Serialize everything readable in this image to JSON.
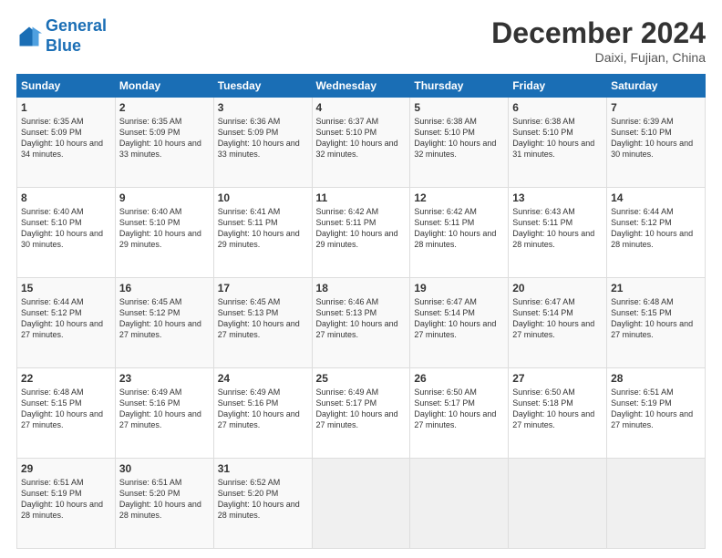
{
  "header": {
    "logo_line1": "General",
    "logo_line2": "Blue",
    "month_title": "December 2024",
    "location": "Daixi, Fujian, China"
  },
  "weekdays": [
    "Sunday",
    "Monday",
    "Tuesday",
    "Wednesday",
    "Thursday",
    "Friday",
    "Saturday"
  ],
  "weeks": [
    [
      {
        "day": "1",
        "sunrise": "6:35 AM",
        "sunset": "5:09 PM",
        "daylight": "10 hours and 34 minutes."
      },
      {
        "day": "2",
        "sunrise": "6:35 AM",
        "sunset": "5:09 PM",
        "daylight": "10 hours and 33 minutes."
      },
      {
        "day": "3",
        "sunrise": "6:36 AM",
        "sunset": "5:09 PM",
        "daylight": "10 hours and 33 minutes."
      },
      {
        "day": "4",
        "sunrise": "6:37 AM",
        "sunset": "5:10 PM",
        "daylight": "10 hours and 32 minutes."
      },
      {
        "day": "5",
        "sunrise": "6:38 AM",
        "sunset": "5:10 PM",
        "daylight": "10 hours and 32 minutes."
      },
      {
        "day": "6",
        "sunrise": "6:38 AM",
        "sunset": "5:10 PM",
        "daylight": "10 hours and 31 minutes."
      },
      {
        "day": "7",
        "sunrise": "6:39 AM",
        "sunset": "5:10 PM",
        "daylight": "10 hours and 30 minutes."
      }
    ],
    [
      {
        "day": "8",
        "sunrise": "6:40 AM",
        "sunset": "5:10 PM",
        "daylight": "10 hours and 30 minutes."
      },
      {
        "day": "9",
        "sunrise": "6:40 AM",
        "sunset": "5:10 PM",
        "daylight": "10 hours and 29 minutes."
      },
      {
        "day": "10",
        "sunrise": "6:41 AM",
        "sunset": "5:11 PM",
        "daylight": "10 hours and 29 minutes."
      },
      {
        "day": "11",
        "sunrise": "6:42 AM",
        "sunset": "5:11 PM",
        "daylight": "10 hours and 29 minutes."
      },
      {
        "day": "12",
        "sunrise": "6:42 AM",
        "sunset": "5:11 PM",
        "daylight": "10 hours and 28 minutes."
      },
      {
        "day": "13",
        "sunrise": "6:43 AM",
        "sunset": "5:11 PM",
        "daylight": "10 hours and 28 minutes."
      },
      {
        "day": "14",
        "sunrise": "6:44 AM",
        "sunset": "5:12 PM",
        "daylight": "10 hours and 28 minutes."
      }
    ],
    [
      {
        "day": "15",
        "sunrise": "6:44 AM",
        "sunset": "5:12 PM",
        "daylight": "10 hours and 27 minutes."
      },
      {
        "day": "16",
        "sunrise": "6:45 AM",
        "sunset": "5:12 PM",
        "daylight": "10 hours and 27 minutes."
      },
      {
        "day": "17",
        "sunrise": "6:45 AM",
        "sunset": "5:13 PM",
        "daylight": "10 hours and 27 minutes."
      },
      {
        "day": "18",
        "sunrise": "6:46 AM",
        "sunset": "5:13 PM",
        "daylight": "10 hours and 27 minutes."
      },
      {
        "day": "19",
        "sunrise": "6:47 AM",
        "sunset": "5:14 PM",
        "daylight": "10 hours and 27 minutes."
      },
      {
        "day": "20",
        "sunrise": "6:47 AM",
        "sunset": "5:14 PM",
        "daylight": "10 hours and 27 minutes."
      },
      {
        "day": "21",
        "sunrise": "6:48 AM",
        "sunset": "5:15 PM",
        "daylight": "10 hours and 27 minutes."
      }
    ],
    [
      {
        "day": "22",
        "sunrise": "6:48 AM",
        "sunset": "5:15 PM",
        "daylight": "10 hours and 27 minutes."
      },
      {
        "day": "23",
        "sunrise": "6:49 AM",
        "sunset": "5:16 PM",
        "daylight": "10 hours and 27 minutes."
      },
      {
        "day": "24",
        "sunrise": "6:49 AM",
        "sunset": "5:16 PM",
        "daylight": "10 hours and 27 minutes."
      },
      {
        "day": "25",
        "sunrise": "6:49 AM",
        "sunset": "5:17 PM",
        "daylight": "10 hours and 27 minutes."
      },
      {
        "day": "26",
        "sunrise": "6:50 AM",
        "sunset": "5:17 PM",
        "daylight": "10 hours and 27 minutes."
      },
      {
        "day": "27",
        "sunrise": "6:50 AM",
        "sunset": "5:18 PM",
        "daylight": "10 hours and 27 minutes."
      },
      {
        "day": "28",
        "sunrise": "6:51 AM",
        "sunset": "5:19 PM",
        "daylight": "10 hours and 27 minutes."
      }
    ],
    [
      {
        "day": "29",
        "sunrise": "6:51 AM",
        "sunset": "5:19 PM",
        "daylight": "10 hours and 28 minutes."
      },
      {
        "day": "30",
        "sunrise": "6:51 AM",
        "sunset": "5:20 PM",
        "daylight": "10 hours and 28 minutes."
      },
      {
        "day": "31",
        "sunrise": "6:52 AM",
        "sunset": "5:20 PM",
        "daylight": "10 hours and 28 minutes."
      },
      null,
      null,
      null,
      null
    ]
  ]
}
